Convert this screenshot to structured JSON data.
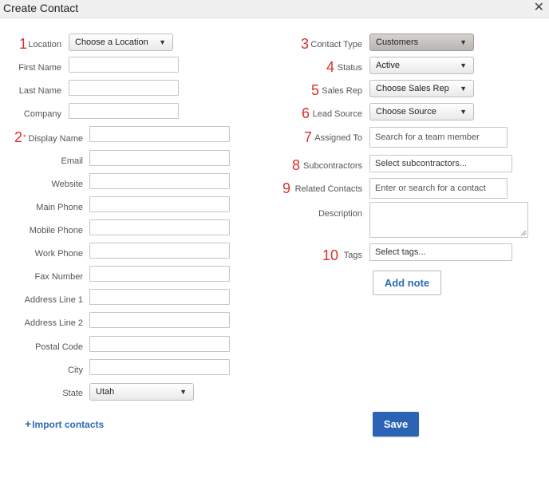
{
  "dialog": {
    "title": "Create Contact",
    "close_icon": "close-icon"
  },
  "steps": [
    "1",
    "2",
    "3",
    "4",
    "5",
    "6",
    "7",
    "8",
    "9",
    "10"
  ],
  "left": {
    "location": {
      "label": "Location",
      "value": "Choose a Location"
    },
    "first_name": {
      "label": "First Name",
      "value": ""
    },
    "last_name": {
      "label": "Last Name",
      "value": ""
    },
    "company": {
      "label": "Company",
      "value": ""
    },
    "display_name": {
      "label": "Display Name",
      "required_mark": "*",
      "value": ""
    },
    "email": {
      "label": "Email",
      "value": ""
    },
    "website": {
      "label": "Website",
      "value": ""
    },
    "main_phone": {
      "label": "Main Phone",
      "value": ""
    },
    "mobile_phone": {
      "label": "Mobile Phone",
      "value": ""
    },
    "work_phone": {
      "label": "Work Phone",
      "value": ""
    },
    "fax_number": {
      "label": "Fax Number",
      "value": ""
    },
    "address1": {
      "label": "Address Line 1",
      "value": ""
    },
    "address2": {
      "label": "Address Line 2",
      "value": ""
    },
    "postal_code": {
      "label": "Postal Code",
      "value": ""
    },
    "city": {
      "label": "City",
      "value": ""
    },
    "state": {
      "label": "State",
      "value": "Utah"
    }
  },
  "right": {
    "contact_type": {
      "label": "Contact Type",
      "value": "Customers"
    },
    "status": {
      "label": "Status",
      "value": "Active"
    },
    "sales_rep": {
      "label": "Sales Rep",
      "value": "Choose Sales Rep"
    },
    "lead_source": {
      "label": "Lead Source",
      "value": "Choose Source"
    },
    "assigned_to": {
      "label": "Assigned To",
      "placeholder": "Search for a team member"
    },
    "subcontractors": {
      "label": "Subcontractors",
      "placeholder": "Select subcontractors..."
    },
    "related_contacts": {
      "label": "Related Contacts",
      "placeholder": "Enter or search for a contact"
    },
    "description": {
      "label": "Description",
      "value": ""
    },
    "tags": {
      "label": "Tags",
      "placeholder": "Select tags..."
    }
  },
  "actions": {
    "add_note": "Add note",
    "save": "Save",
    "import_contacts": "Import contacts",
    "import_plus": "+"
  },
  "colors": {
    "step_red": "#d9302b",
    "link_blue": "#2c6bb3",
    "save_blue": "#2b63b5"
  }
}
